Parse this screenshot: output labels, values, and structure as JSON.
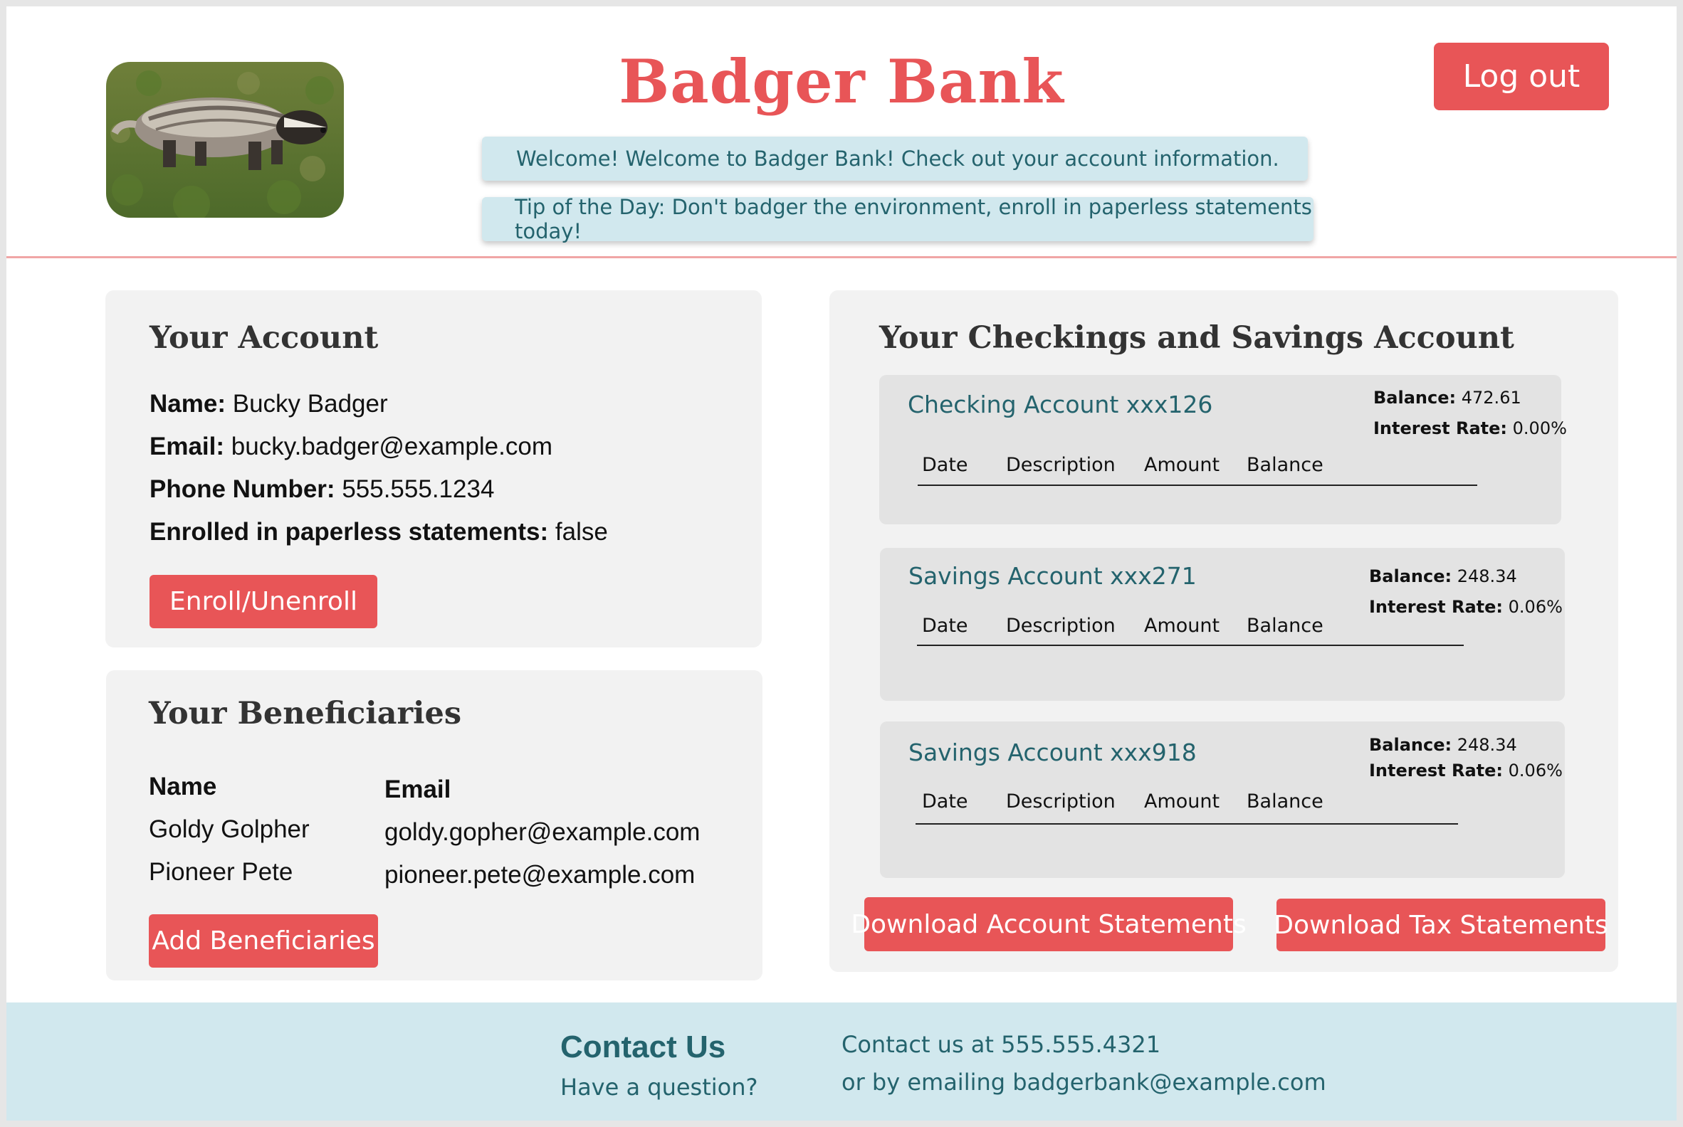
{
  "header": {
    "title": "Badger Bank",
    "logout_label": "Log out",
    "welcome": "Welcome! Welcome to Badger Bank! Check out your account information.",
    "tip": "Tip of the Day: Don't badger the environment, enroll in paperless statements today!"
  },
  "account": {
    "title": "Your Account",
    "fields": [
      {
        "label": "Name:",
        "value": "Bucky Badger"
      },
      {
        "label": "Email:",
        "value": "bucky.badger@example.com"
      },
      {
        "label": "Phone Number:",
        "value": "555.555.1234"
      },
      {
        "label": "Enrolled in paperless statements:",
        "value": "false"
      }
    ],
    "enroll_label": "Enroll/Unenroll"
  },
  "beneficiaries": {
    "title": "Your Beneficiaries",
    "headers": {
      "name": "Name",
      "email": "Email"
    },
    "rows": [
      {
        "name": "Goldy Golpher",
        "email": "goldy.gopher@example.com"
      },
      {
        "name": "Pioneer Pete",
        "email": "pioneer.pete@example.com"
      }
    ],
    "add_label": "Add Beneficiaries"
  },
  "accounts_panel": {
    "title": "Your Checkings and Savings Account",
    "balance_label": "Balance:",
    "rate_label": "Interest Rate:",
    "columns": [
      "Date",
      "Description",
      "Amount",
      "Balance"
    ],
    "accounts": [
      {
        "name": "Checking Account xxx126",
        "balance": "472.61",
        "rate": "0.00%"
      },
      {
        "name": "Savings Account xxx271",
        "balance": "248.34",
        "rate": "0.06%"
      },
      {
        "name": "Savings Account xxx918",
        "balance": "248.34",
        "rate": "0.06%"
      }
    ],
    "download_account_label": "Download Account Statements",
    "download_tax_label": "Download Tax Statements"
  },
  "footer": {
    "title": "Contact Us",
    "subtitle": "Have a question?",
    "line1": "Contact us at 555.555.4321",
    "line2": "or by emailing badgerbank@example.com"
  },
  "colors": {
    "accent": "#e85557",
    "teal_text": "#24636d",
    "banner_bg": "#d1e8ee",
    "card_bg": "#f2f2f2"
  }
}
